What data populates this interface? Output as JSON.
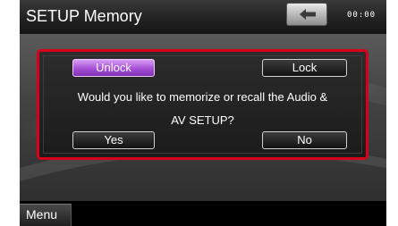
{
  "header": {
    "title": "SETUP Memory",
    "clock": "00:00",
    "back_icon": "back-arrow-icon"
  },
  "dialog": {
    "unlock_label": "Unlock",
    "lock_label": "Lock",
    "message_line1": "Would you like to memorize or recall the Audio &",
    "message_line2": "AV SETUP?",
    "yes_label": "Yes",
    "no_label": "No",
    "active_button": "Unlock"
  },
  "footer": {
    "menu_label": "Menu"
  },
  "colors": {
    "accent_active": "#a64fd6",
    "highlight_frame": "#d8001a",
    "background": "#000000"
  }
}
